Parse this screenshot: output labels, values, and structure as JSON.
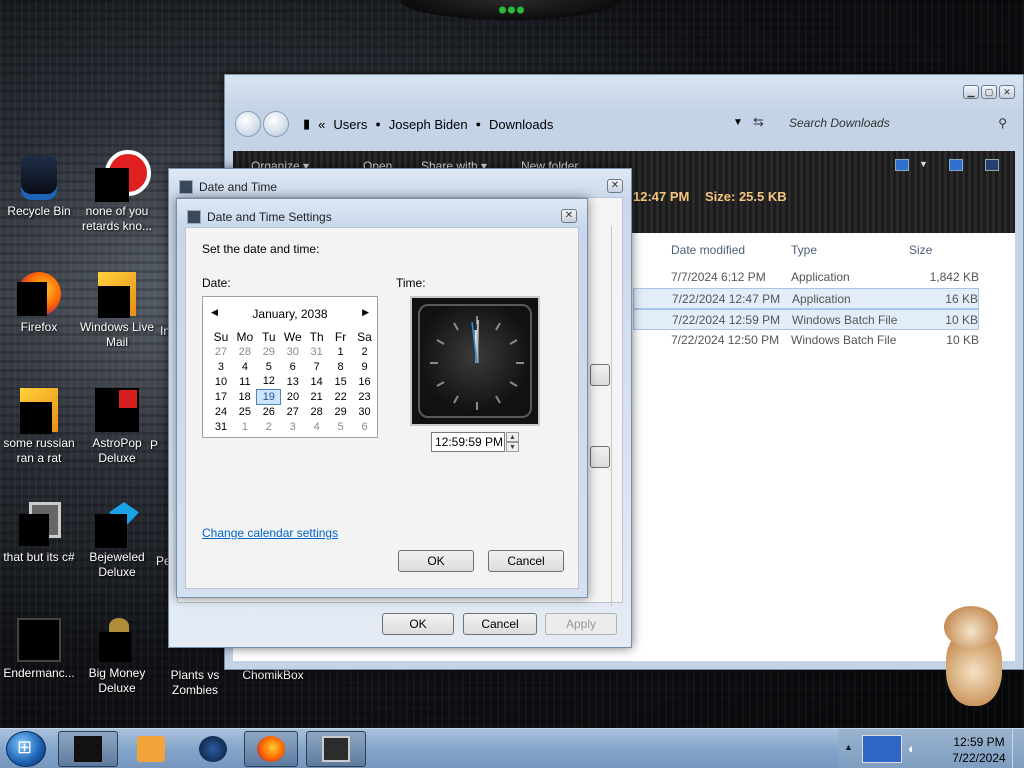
{
  "desktop": {
    "icons": [
      {
        "label": "Recycle Bin"
      },
      {
        "label": "none of you retards kno..."
      },
      {
        "label": "Firefox"
      },
      {
        "label": "Windows Live Mail"
      },
      {
        "label": "some russian ran a rat"
      },
      {
        "label": "AstroPop Deluxe"
      },
      {
        "label": "that but its c#"
      },
      {
        "label": "Bejeweled Deluxe"
      },
      {
        "label": "Endermanc..."
      },
      {
        "label": "Big Money Deluxe"
      },
      {
        "label": "Plants vs Zombies"
      },
      {
        "label": "ChomikBox"
      },
      {
        "label": "P"
      },
      {
        "label": "In"
      },
      {
        "label": "Pe"
      }
    ]
  },
  "explorer": {
    "breadcrumb_chevron": "«",
    "breadcrumbs": [
      "Users",
      "Joseph Biden",
      "Downloads"
    ],
    "search_placeholder": "Search Downloads",
    "toolbar": {
      "organize": "Organize ▾",
      "open": "Open",
      "share": "Share with ▾",
      "new_folder": "New folder"
    },
    "details_time": "12:47 PM",
    "details_size": "Size: 25.5 KB",
    "columns": {
      "date": "Date modified",
      "type": "Type",
      "size": "Size"
    },
    "files": [
      {
        "date": "7/7/2024 6:12 PM",
        "type": "Application",
        "size": "1,842 KB"
      },
      {
        "date": "7/22/2024 12:47 PM",
        "type": "Application",
        "size": "16 KB"
      },
      {
        "date": "7/22/2024 12:59 PM",
        "type": "Windows Batch File",
        "size": "10 KB"
      },
      {
        "date": "7/22/2024 12:50 PM",
        "type": "Windows Batch File",
        "size": "10 KB"
      }
    ]
  },
  "outer_dialog": {
    "title": "Date and Time",
    "ok": "OK",
    "cancel": "Cancel",
    "apply": "Apply"
  },
  "inner_dialog": {
    "title": "Date and Time Settings",
    "instruction": "Set the date and time:",
    "date_label": "Date:",
    "time_label": "Time:",
    "month": "January, 2038",
    "weekdays": [
      "Su",
      "Mo",
      "Tu",
      "We",
      "Th",
      "Fr",
      "Sa"
    ],
    "weeks": [
      [
        "27",
        "28",
        "29",
        "30",
        "31",
        "1",
        "2"
      ],
      [
        "3",
        "4",
        "5",
        "6",
        "7",
        "8",
        "9"
      ],
      [
        "10",
        "11",
        "12",
        "13",
        "14",
        "15",
        "16"
      ],
      [
        "17",
        "18",
        "19",
        "20",
        "21",
        "22",
        "23"
      ],
      [
        "24",
        "25",
        "26",
        "27",
        "28",
        "29",
        "30"
      ],
      [
        "31",
        "1",
        "2",
        "3",
        "4",
        "5",
        "6"
      ]
    ],
    "selected_day": "19",
    "time_value": "12:59:59 PM",
    "change_calendar": "Change calendar settings",
    "ok": "OK",
    "cancel": "Cancel"
  },
  "taskbar": {
    "clock_time": "12:59 PM",
    "clock_date": "7/22/2024"
  },
  "colors": {
    "accent": "#1b5fb0",
    "selection": "#cfe4fb",
    "link": "#0066cc"
  }
}
